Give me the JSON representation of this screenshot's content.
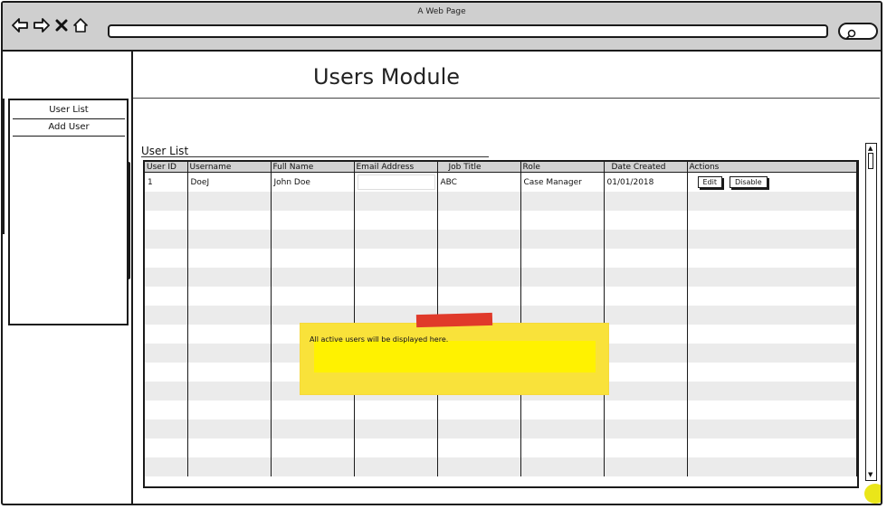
{
  "window": {
    "title": "A Web Page"
  },
  "page": {
    "title": "Users Module"
  },
  "sidebar": {
    "items": [
      {
        "label": "User List"
      },
      {
        "label": "Add User"
      }
    ]
  },
  "section": {
    "title": "User List"
  },
  "table": {
    "headers": [
      "User ID",
      "Username",
      "Full Name",
      "Email Address",
      "Job Title",
      "Role",
      "Date Created",
      "Actions"
    ],
    "rows": [
      {
        "user_id": "1",
        "username": "DoeJ",
        "full_name": "John Doe",
        "email": "",
        "job_title": "ABC",
        "role": "Case Manager",
        "date_created": "01/01/2018",
        "actions": {
          "edit": "Edit",
          "disable": "Disable"
        }
      }
    ],
    "empty_rows": 15
  },
  "note": {
    "text": "All active users will be displayed here."
  },
  "colors": {
    "chrome": "#cfcfcf",
    "sticky": "#f9e23a",
    "sticky_inner": "#fff200",
    "tape": "#e03a2a",
    "header_row": "#d2d2d2",
    "stripe": "#ebebeb"
  },
  "icons": {
    "back": "back-arrow-icon",
    "forward": "forward-arrow-icon",
    "close": "close-icon",
    "home": "home-icon",
    "search": "search-icon"
  }
}
